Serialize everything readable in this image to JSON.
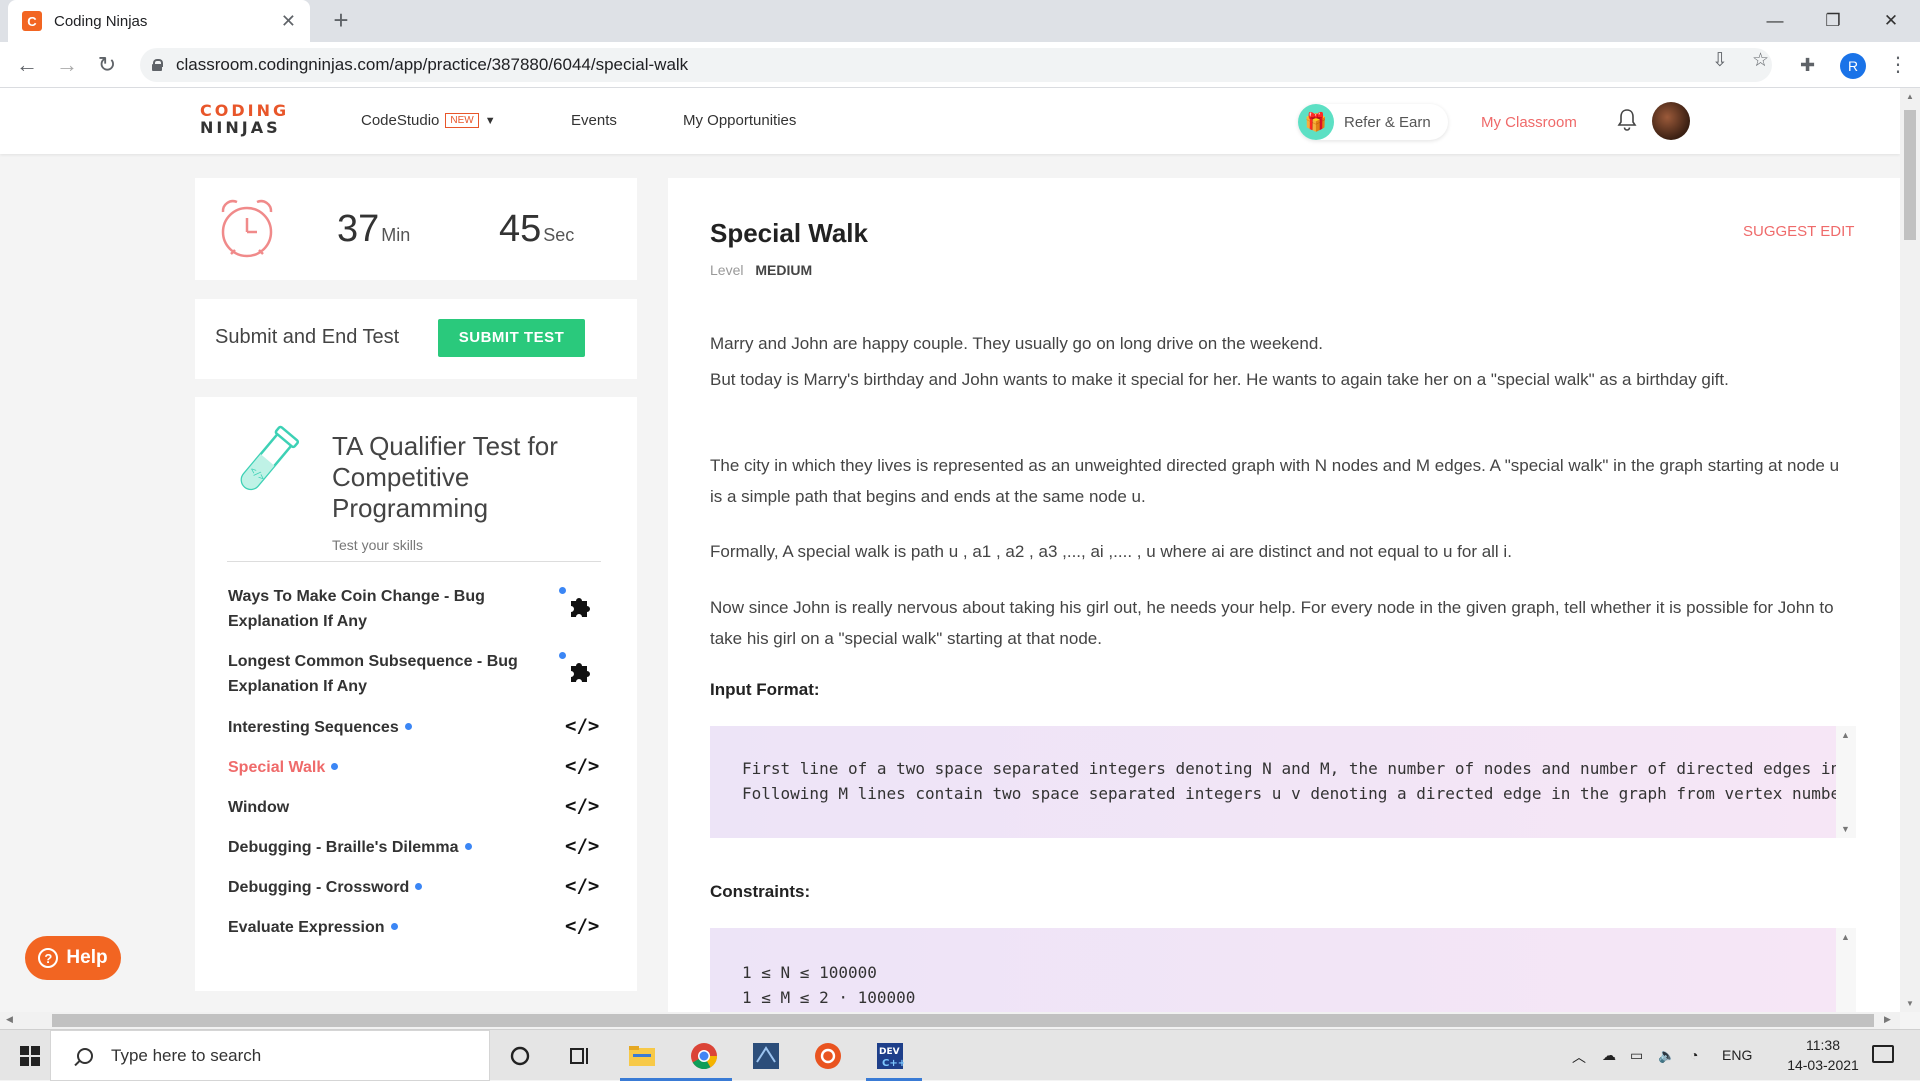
{
  "browser": {
    "tab_title": "Coding Ninjas",
    "tab_favicon_letter": "C",
    "url": "classroom.codingninjas.com/app/practice/387880/6044/special-walk",
    "profile_initial": "R"
  },
  "header": {
    "logo_top": "CODING",
    "logo_bottom": "NINJAS",
    "nav": {
      "codestudio": "CodeStudio",
      "new_badge": "NEW",
      "events": "Events",
      "opportunities": "My Opportunities"
    },
    "refer_label": "Refer & Earn",
    "my_classroom": "My Classroom"
  },
  "timer": {
    "minutes": "37",
    "min_unit": "Min",
    "seconds": "45",
    "sec_unit": "Sec"
  },
  "submit": {
    "label": "Submit and End Test",
    "button": "SUBMIT   TEST"
  },
  "test": {
    "title": "TA Qualifier Test for Competitive Programming",
    "subtitle": "Test your skills",
    "questions": [
      {
        "line1": "Ways To Make Coin Change - Bug",
        "line2": "Explanation If Any",
        "icon": "puzzle-icon"
      },
      {
        "line1": "Longest Common Subsequence - Bug",
        "line2": "Explanation If Any",
        "icon": "puzzle-icon"
      },
      {
        "label": "Interesting Sequences",
        "icon": "code-icon"
      },
      {
        "label": "Special Walk",
        "icon": "code-icon",
        "active": true
      },
      {
        "label": "Window",
        "icon": "code-icon"
      },
      {
        "label": "Debugging - Braille's Dilemma",
        "icon": "code-icon"
      },
      {
        "label": "Debugging - Crossword",
        "icon": "code-icon"
      },
      {
        "label": "Evaluate Expression",
        "icon": "code-icon"
      }
    ]
  },
  "help_label": "Help",
  "problem": {
    "title": "Special Walk",
    "level_label": "Level",
    "level_value": "MEDIUM",
    "suggest_edit": "SUGGEST EDIT",
    "p1": "Marry and John are happy couple. They usually go on long drive on the weekend.",
    "p2": "But today is Marry's birthday and John wants to make it special for her. He wants to again take her on a \"special walk\" as a birthday gift.",
    "p3": "The city in which they lives is represented as an unweighted directed graph with N nodes and M edges. A \"special walk\" in the graph starting at node u is a simple path that begins and ends at the same node u.",
    "p4": "Formally, A special walk is path u , a1 , a2 , a3 ,..., ai ,.... , u where ai are distinct and not equal to u for all i.",
    "p5": "Now since John is really nervous about taking his girl out, he needs your help. For every node in the given graph, tell whether it is possible for John to take his girl on a \"special walk\" starting at that node.",
    "input_format_heading": "Input Format:",
    "input_line1": "First line of a two space separated integers denoting N and M, the number of nodes and number of directed edges in",
    "input_line2": "Following M lines contain two space separated integers u v denoting a directed edge in the graph from vertex number",
    "constraints_heading": "Constraints:",
    "constraint1": "1 ≤ N ≤ 100000",
    "constraint2": "1 ≤ M ≤ 2 · 100000"
  },
  "taskbar": {
    "search_placeholder": "Type here to search",
    "lang": "ENG",
    "time": "11:38",
    "date": "14-03-2021"
  },
  "colors": {
    "brand_orange": "#f26522",
    "accent_red": "#ef6a6a",
    "submit_green": "#2ac97c",
    "dot_blue": "#3b86f5"
  }
}
